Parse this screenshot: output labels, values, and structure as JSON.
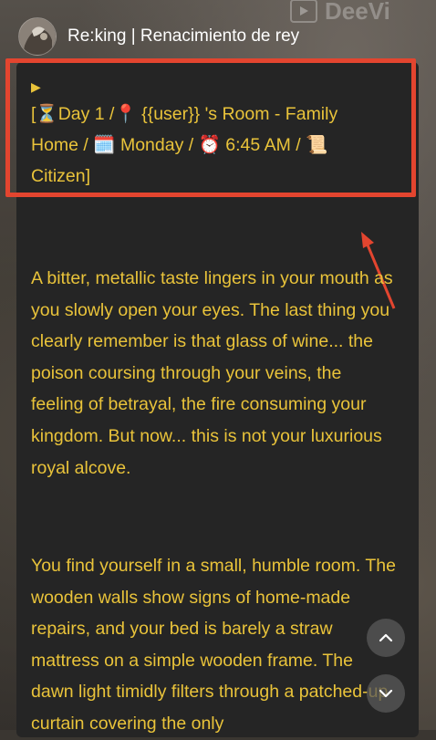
{
  "header": {
    "title": "Re:king | Renacimiento de rey"
  },
  "watermark": {
    "text": "DeeVi"
  },
  "message": {
    "play_symbol": "▶",
    "status_line_1": "[⏳Day 1 /📍 {{user}} 's Room - Family",
    "status_line_2": "Home / 🗓️ Monday / ⏰ 6:45 AM / 📜",
    "status_line_3": "Citizen]",
    "paragraph_1": "A bitter, metallic taste lingers in your mouth as you slowly open your eyes. The last thing you clearly remember is that glass of wine... the poison coursing through your veins, the feeling of betrayal, the fire consuming your kingdom. But now... this is not your luxurious royal alcove.",
    "paragraph_2": "You find yourself in a small, humble room. The wooden walls show signs of home-made repairs, and your bed is barely a straw mattress on a simple wooden frame. The dawn light timidly filters through a patched-up curtain covering the only"
  },
  "colors": {
    "text_accent": "#e9c33a",
    "highlight_box": "#e3452f",
    "card_background": "#252525"
  },
  "icons": {
    "scroll_up": "chevron-up-icon",
    "scroll_down": "chevron-down-icon",
    "annotation": "red-arrow-annotation"
  }
}
